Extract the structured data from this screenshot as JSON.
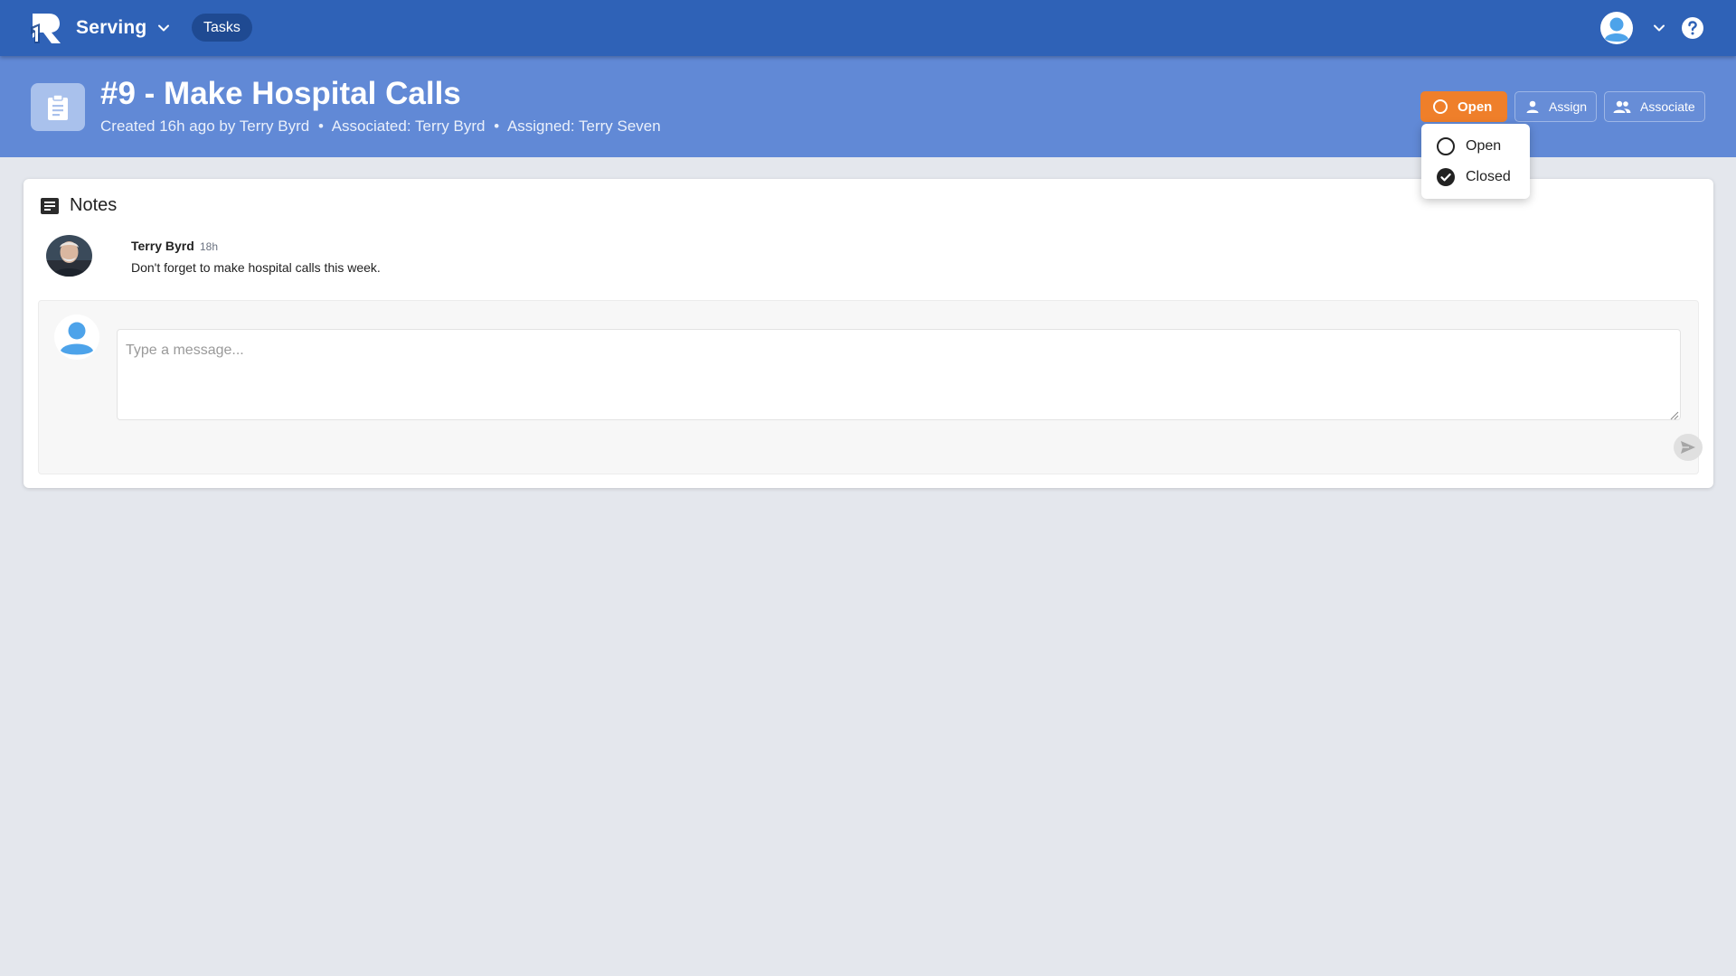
{
  "topbar": {
    "logo_icon": "r-brand-logo-icon",
    "app_name": "Serving",
    "nav_tab": "Tasks",
    "user_icon": "user-avatar-icon",
    "help_icon": "question-circle-icon"
  },
  "task": {
    "title": "#9 - Make Hospital Calls",
    "meta": {
      "created": "Created 16h ago by Terry Byrd",
      "associated": "Associated: Terry Byrd",
      "assigned": "Assigned: Terry Seven",
      "separator": "•"
    },
    "icon": "clipboard-icon"
  },
  "actions": {
    "status_label": "Open",
    "assign_label": "Assign",
    "associate_label": "Associate"
  },
  "status_menu": {
    "options": [
      {
        "label": "Open",
        "icon": "circle-outline-icon"
      },
      {
        "label": "Closed",
        "icon": "check-circle-icon"
      }
    ]
  },
  "notes": {
    "title": "Notes",
    "icon": "note-icon",
    "items": [
      {
        "author": "Terry Byrd",
        "time": "18h",
        "text": "Don't forget to make hospital calls this week."
      }
    ],
    "composer": {
      "placeholder": "Type a message...",
      "send_icon": "send-icon"
    }
  },
  "colors": {
    "topbar": "#2f62b7",
    "header_band": "#6189d6",
    "status_button": "#ef7f2a",
    "page_background": "#e4e7ed"
  }
}
